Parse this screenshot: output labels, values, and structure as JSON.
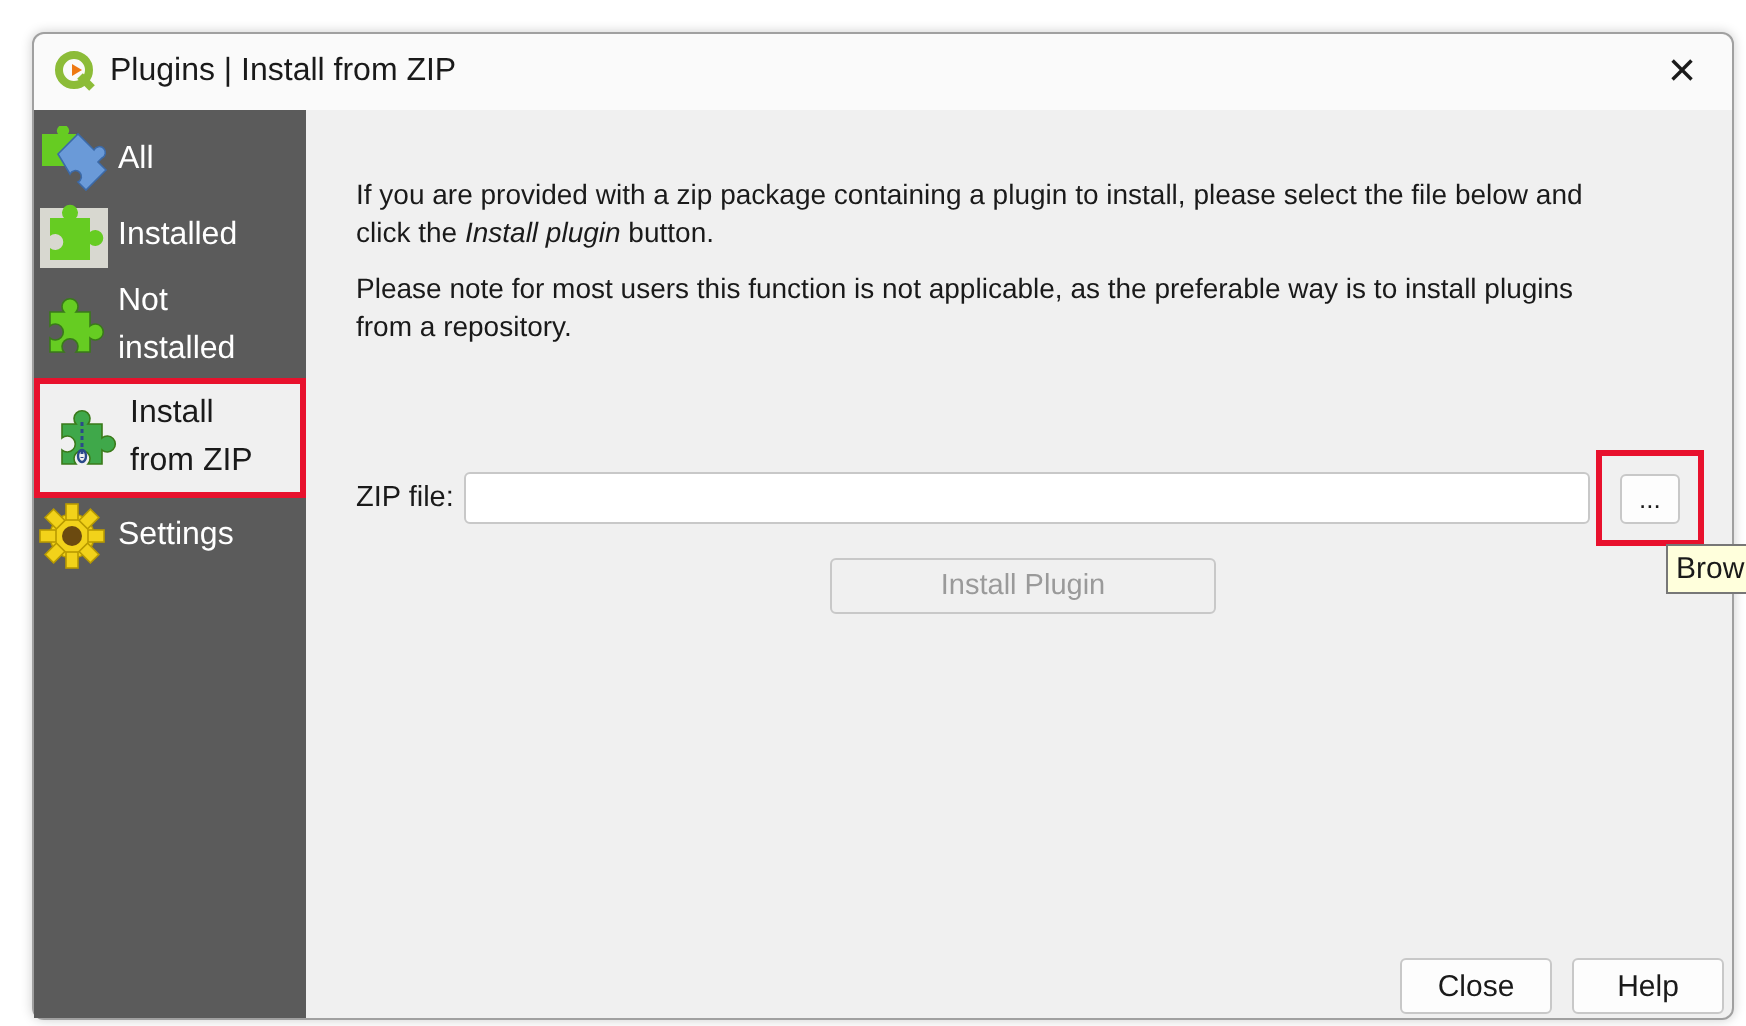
{
  "window": {
    "title": "Plugins | Install from ZIP",
    "close": "×"
  },
  "sidebar": {
    "items": [
      {
        "label": "All",
        "kind": "all",
        "selected": false,
        "highlighted": false
      },
      {
        "label": "Installed",
        "kind": "installed",
        "selected": false,
        "highlighted": false
      },
      {
        "label": "Not installed",
        "kind": "not_installed",
        "selected": false,
        "highlighted": false
      },
      {
        "label": "Install from ZIP",
        "kind": "zip",
        "selected": true,
        "highlighted": true
      },
      {
        "label": "Settings",
        "kind": "settings",
        "selected": false,
        "highlighted": false
      }
    ]
  },
  "content": {
    "paragraphs": [
      "If you are provided with a zip package containing a plugin to install, please select the file below and click the *Install plugin* button.",
      "Please note for most users this function is not applicable, as the preferable way is to install plugins from a repository."
    ],
    "zip_file": {
      "label": "ZIP file:",
      "browse": {
        "label": "...",
        "highlighted": true,
        "tooltip": "Brow"
      }
    },
    "install_button": {
      "label": "Install Plugin",
      "disabled": true
    }
  },
  "buttons": [
    "Close",
    "Help"
  ]
}
